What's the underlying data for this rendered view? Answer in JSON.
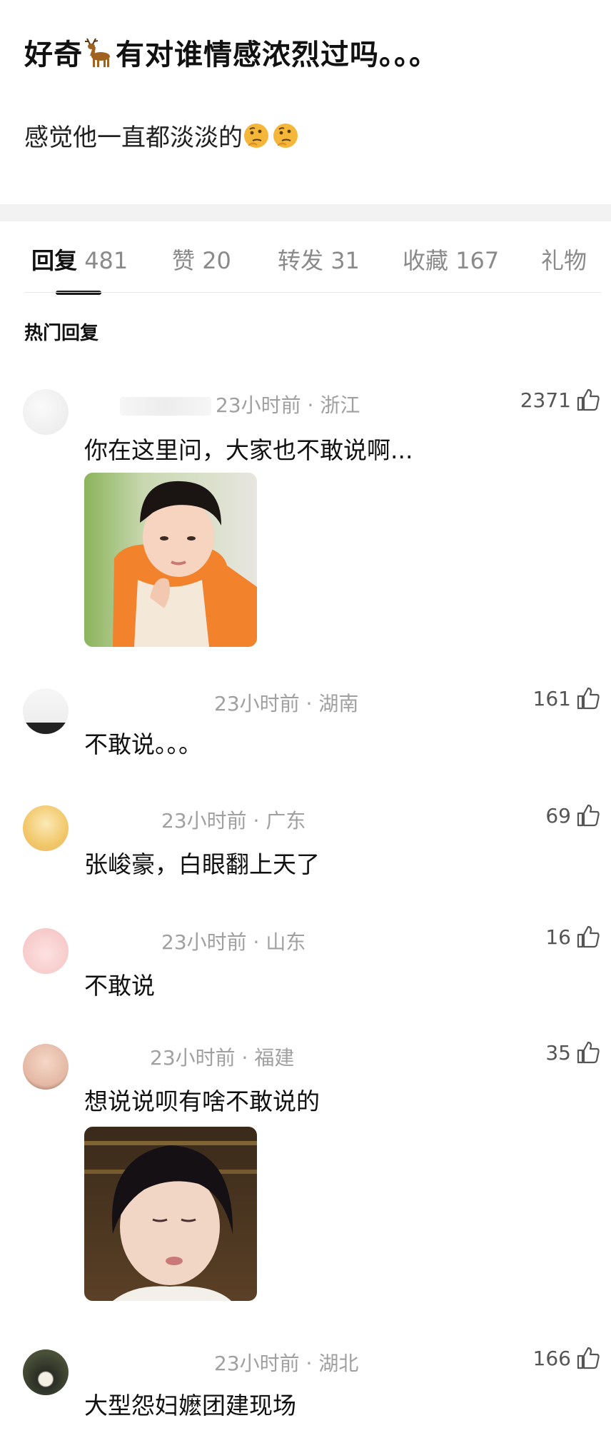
{
  "post": {
    "title_prefix": "好奇",
    "title_emoji": "🦌",
    "title_suffix": "有对谁情感浓烈过吗。。。",
    "body": "感觉他一直都淡淡的",
    "body_emoji": "🤔🤔"
  },
  "tabs": [
    {
      "label": "回复",
      "count": "481"
    },
    {
      "label": "赞",
      "count": "20"
    },
    {
      "label": "转发",
      "count": "31"
    },
    {
      "label": "收藏",
      "count": "167"
    },
    {
      "label": "礼物",
      "count": ""
    }
  ],
  "section_title": "热门回复",
  "comments": [
    {
      "meta": "23小时前 · 浙江",
      "likes": "2371",
      "text": "你在这里问，大家也不敢说啊..."
    },
    {
      "meta": "23小时前 · 湖南",
      "likes": "161",
      "text": "不敢说。。。"
    },
    {
      "meta": "23小时前 · 广东",
      "likes": "69",
      "text": "张峻豪，白眼翻上天了"
    },
    {
      "meta": "23小时前 · 山东",
      "likes": "16",
      "text": "不敢说"
    },
    {
      "meta": "23小时前 · 福建",
      "likes": "35",
      "text": "想说说呗有啥不敢说的"
    },
    {
      "meta": "23小时前 · 湖北",
      "likes": "166",
      "text": "大型怨妇嬷团建现场"
    }
  ],
  "colors": {
    "text_primary": "#111111",
    "text_secondary": "#8a8a8a",
    "divider_band": "#f2f2f2"
  },
  "icons": {
    "like": "thumbs-up-icon",
    "deer": "deer-emoji",
    "thinking": "thinking-face-emoji"
  }
}
